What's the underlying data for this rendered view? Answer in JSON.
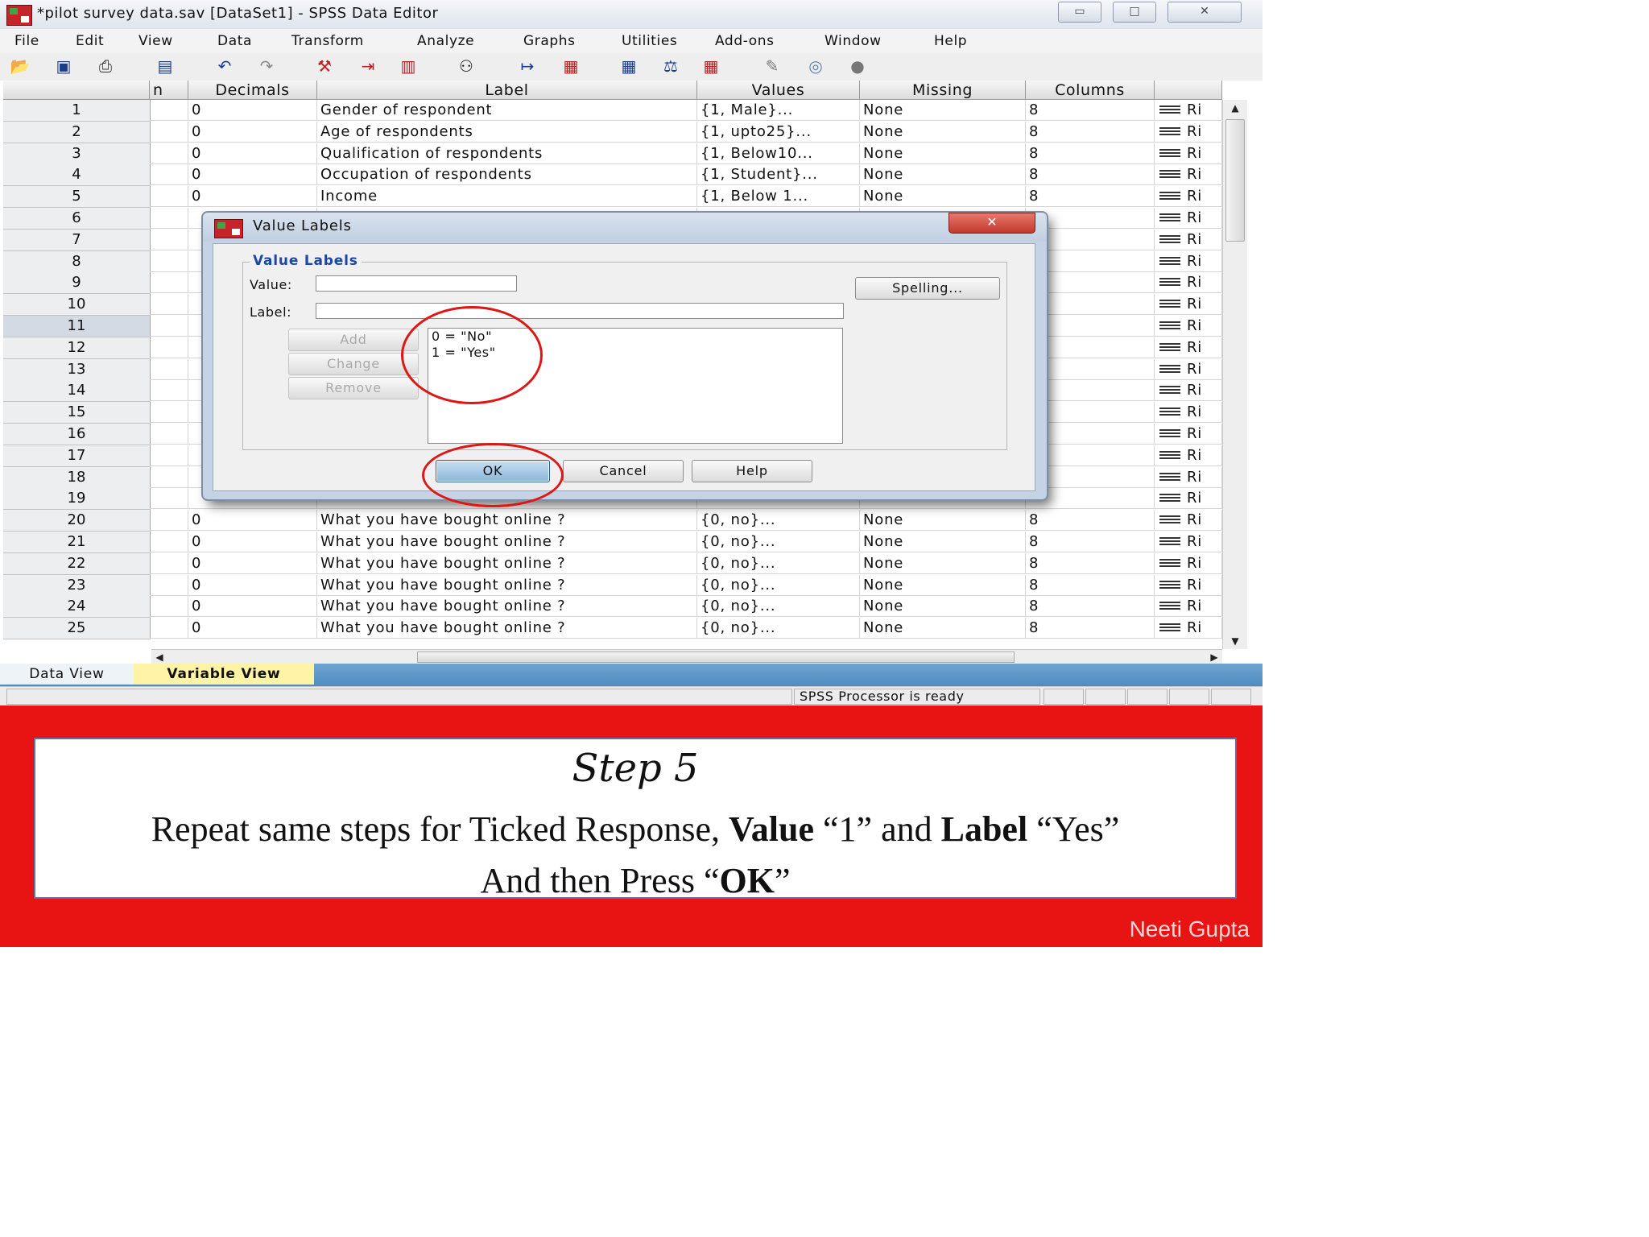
{
  "window": {
    "title": "*pilot survey data.sav [DataSet1] - SPSS Data Editor",
    "minimize_glyph": "▭",
    "maximize_glyph": "□",
    "close_glyph": "✕"
  },
  "menu": [
    "File",
    "Edit",
    "View",
    "Data",
    "Transform",
    "Analyze",
    "Graphs",
    "Utilities",
    "Add-ons",
    "Window",
    "Help"
  ],
  "toolbar_icons": [
    "open-folder-icon",
    "save-icon",
    "print-icon",
    "dialog-recall-icon",
    "undo-icon",
    "redo-icon",
    "goto-case-icon",
    "insert-variable-icon",
    "variables-icon",
    "find-icon",
    "insert-cases-icon",
    "split-file-icon",
    "select-cases-icon",
    "weight-cases-icon",
    "value-labels-icon",
    "use-sets-icon",
    "show-all-icon",
    "spell-icon"
  ],
  "grid": {
    "headers": {
      "partial": "n",
      "decimals": "Decimals",
      "label": "Label",
      "values": "Values",
      "missing": "Missing",
      "columns": "Columns"
    },
    "rows": [
      {
        "num": "1",
        "decimals": "0",
        "label": "Gender of respondent",
        "values": "{1, Male}...",
        "missing": "None",
        "columns": "8",
        "align": "Ri"
      },
      {
        "num": "2",
        "decimals": "0",
        "label": "Age of respondents",
        "values": "{1, upto25}...",
        "missing": "None",
        "columns": "8",
        "align": "Ri"
      },
      {
        "num": "3",
        "decimals": "0",
        "label": "Qualification of respondents",
        "values": "{1, Below10...",
        "missing": "None",
        "columns": "8",
        "align": "Ri"
      },
      {
        "num": "4",
        "decimals": "0",
        "label": "Occupation of respondents",
        "values": "{1, Student}...",
        "missing": "None",
        "columns": "8",
        "align": "Ri"
      },
      {
        "num": "5",
        "decimals": "0",
        "label": "Income",
        "values": "{1, Below 1...",
        "missing": "None",
        "columns": "8",
        "align": "Ri"
      },
      {
        "num": "6",
        "decimals": "",
        "label": "",
        "values": "",
        "missing": "",
        "columns": "",
        "align": "Ri"
      },
      {
        "num": "7",
        "decimals": "",
        "label": "",
        "values": "",
        "missing": "",
        "columns": "",
        "align": "Ri"
      },
      {
        "num": "8",
        "decimals": "",
        "label": "",
        "values": "",
        "missing": "",
        "columns": "",
        "align": "Ri"
      },
      {
        "num": "9",
        "decimals": "",
        "label": "",
        "values": "",
        "missing": "",
        "columns": "",
        "align": "Ri"
      },
      {
        "num": "10",
        "decimals": "",
        "label": "",
        "values": "",
        "missing": "",
        "columns": "",
        "align": "Ri"
      },
      {
        "num": "11",
        "decimals": "",
        "label": "",
        "values": "",
        "missing": "",
        "columns": "",
        "align": "Ri"
      },
      {
        "num": "12",
        "decimals": "",
        "label": "",
        "values": "",
        "missing": "",
        "columns": "",
        "align": "Ri"
      },
      {
        "num": "13",
        "decimals": "",
        "label": "",
        "values": "",
        "missing": "",
        "columns": "",
        "align": "Ri"
      },
      {
        "num": "14",
        "decimals": "",
        "label": "",
        "values": "",
        "missing": "",
        "columns": "",
        "align": "Ri"
      },
      {
        "num": "15",
        "decimals": "",
        "label": "",
        "values": "",
        "missing": "",
        "columns": "",
        "align": "Ri"
      },
      {
        "num": "16",
        "decimals": "",
        "label": "",
        "values": "",
        "missing": "",
        "columns": "",
        "align": "Ri"
      },
      {
        "num": "17",
        "decimals": "",
        "label": "",
        "values": "",
        "missing": "",
        "columns": "",
        "align": "Ri"
      },
      {
        "num": "18",
        "decimals": "",
        "label": "",
        "values": "",
        "missing": "",
        "columns": "",
        "align": "Ri"
      },
      {
        "num": "19",
        "decimals": "",
        "label": "",
        "values": "",
        "missing": "",
        "columns": "",
        "align": "Ri"
      },
      {
        "num": "20",
        "decimals": "0",
        "label": "What  you have bought online ?",
        "values": "{0, no}...",
        "missing": "None",
        "columns": "8",
        "align": "Ri"
      },
      {
        "num": "21",
        "decimals": "0",
        "label": "What  you have bought online ?",
        "values": "{0, no}...",
        "missing": "None",
        "columns": "8",
        "align": "Ri"
      },
      {
        "num": "22",
        "decimals": "0",
        "label": "What  you have bought online ?",
        "values": "{0, no}...",
        "missing": "None",
        "columns": "8",
        "align": "Ri"
      },
      {
        "num": "23",
        "decimals": "0",
        "label": "What  you have bought online ?",
        "values": "{0, no}...",
        "missing": "None",
        "columns": "8",
        "align": "Ri"
      },
      {
        "num": "24",
        "decimals": "0",
        "label": "What  you have bought online ?",
        "values": "{0, no}...",
        "missing": "None",
        "columns": "8",
        "align": "Ri"
      },
      {
        "num": "25",
        "decimals": "0",
        "label": "What  you have bought online ?",
        "values": "{0, no}...",
        "missing": "None",
        "columns": "8",
        "align": "Ri"
      }
    ],
    "selected_row": "11",
    "scroll_up_glyph": "▲",
    "scroll_down_glyph": "▼",
    "scroll_left_glyph": "◀",
    "scroll_right_glyph": "▶"
  },
  "tabs": {
    "data_view": "Data View",
    "variable_view": "Variable View"
  },
  "status": {
    "processor": "SPSS  Processor is ready"
  },
  "dialog": {
    "title": "Value Labels",
    "close_glyph": "✕",
    "group_title": "Value Labels",
    "value_label": "Value:",
    "value_input": "",
    "label_label": "Label:",
    "label_input": "",
    "spelling": "Spelling...",
    "add": "Add",
    "change": "Change",
    "remove": "Remove",
    "list": [
      "0 = \"No\"",
      "1 = \"Yes\""
    ],
    "ok": "OK",
    "cancel": "Cancel",
    "help": "Help"
  },
  "instruction": {
    "step": "Step 5",
    "l1_a": "Repeat same steps for Ticked Response, ",
    "l1_b": "Value",
    "l1_c": " “1” and ",
    "l1_d": "Label",
    "l1_e": " “Yes”",
    "l2_a": "And then Press “",
    "l2_b": "OK",
    "l2_c": "”",
    "watermark": "Neeti Gupta"
  },
  "colors": {
    "banner_red": "#e81313",
    "tab_active": "#fff3a6",
    "group_title_blue": "#1a47a8",
    "highlight_red": "#e01616"
  }
}
